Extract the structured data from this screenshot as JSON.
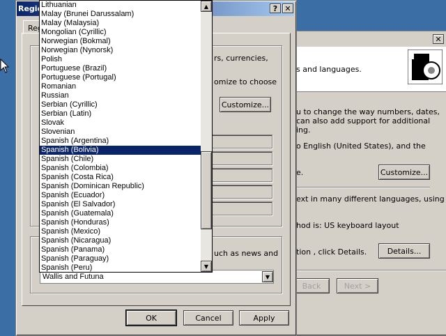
{
  "back_window": {
    "close_glyph": "✕",
    "line1": "s and languages.",
    "line2": "u to change the way numbers, dates,",
    "line3": "can also add support for additional",
    "line4": "ing.",
    "line5": "o English (United States), and the",
    "line6": "e.",
    "customize_label": "Customize...",
    "line7": "ext in many different languages, using",
    "line8": "hod is: US keyboard layout",
    "line9": "tion , click Details.",
    "details_label": "Details...",
    "back_label": "Back",
    "next_label": "Next >"
  },
  "front_window": {
    "title": "Regio",
    "help_glyph": "?",
    "close_glyph": "✕",
    "tab_label": "Reg",
    "text1": "rs, currencies,",
    "text2": "omize to choose",
    "customize_label": "Customize...",
    "text3": "uch as news and",
    "location_value": "Wallis and Futuna",
    "ok_label": "OK",
    "cancel_label": "Cancel",
    "apply_label": "Apply"
  },
  "dropdown": {
    "items": [
      "Lithuanian",
      "Malay (Brunei Darussalam)",
      "Malay (Malaysia)",
      "Mongolian (Cyrillic)",
      "Norwegian (Bokmal)",
      "Norwegian (Nynorsk)",
      "Polish",
      "Portuguese (Brazil)",
      "Portuguese (Portugal)",
      "Romanian",
      "Russian",
      "Serbian (Cyrillic)",
      "Serbian (Latin)",
      "Slovak",
      "Slovenian",
      "Spanish (Argentina)",
      "Spanish (Bolivia)",
      "Spanish (Chile)",
      "Spanish (Colombia)",
      "Spanish (Costa Rica)",
      "Spanish (Dominican Republic)",
      "Spanish (Ecuador)",
      "Spanish (El Salvador)",
      "Spanish (Guatemala)",
      "Spanish (Honduras)",
      "Spanish (Mexico)",
      "Spanish (Nicaragua)",
      "Spanish (Panama)",
      "Spanish (Paraguay)",
      "Spanish (Peru)"
    ],
    "selected": "Spanish (Bolivia)",
    "up_glyph": "▲",
    "down_glyph": "▼"
  },
  "colors": {
    "desktop": "#3a6ea5",
    "selection": "#0a246a",
    "window_face": "#d4d0c8"
  }
}
